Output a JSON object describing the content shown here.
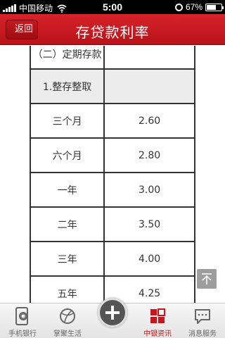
{
  "status_bar": {
    "carrier": "中国移动",
    "time": "5:00",
    "battery": "67%",
    "battery_level": 0.67
  },
  "nav": {
    "back_label": "返回",
    "title": "存贷款利率"
  },
  "table": {
    "rows": [
      {
        "term": "（二）定期存款",
        "rate": "",
        "style": "first"
      },
      {
        "term": "1.整存整取",
        "rate": "",
        "style": "grey"
      },
      {
        "term": "三个月",
        "rate": "2.60",
        "style": ""
      },
      {
        "term": "六个月",
        "rate": "2.80",
        "style": ""
      },
      {
        "term": "一年",
        "rate": "3.00",
        "style": ""
      },
      {
        "term": "二年",
        "rate": "3.50",
        "style": ""
      },
      {
        "term": "三年",
        "rate": "4.00",
        "style": ""
      },
      {
        "term": "五年",
        "rate": "4.25",
        "style": ""
      }
    ]
  },
  "tabs": [
    {
      "label": "手机银行",
      "icon": "phone-bank-icon"
    },
    {
      "label": "掌聚生活",
      "icon": "ball-icon"
    },
    {
      "label": "中银资讯",
      "icon": "grid-icon",
      "active": true
    },
    {
      "label": "消息服务",
      "icon": "message-icon"
    }
  ],
  "colors": {
    "accent": "#c8161e",
    "nav_bg": "#d8232a"
  }
}
